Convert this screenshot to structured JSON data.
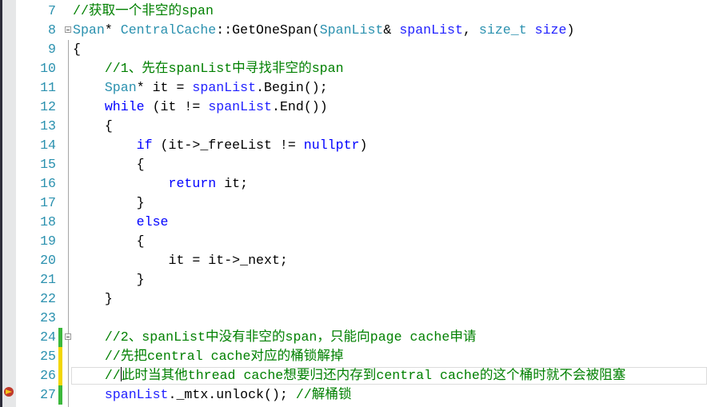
{
  "editor": {
    "colors": {
      "comment": "#008000",
      "keyword": "#0000ff",
      "type": "#2b91af",
      "parameter": "#1f1fff",
      "line_number": "#2b91af",
      "change_saved": "#3cb83c",
      "change_unsaved": "#f2d600"
    },
    "current_line": 26,
    "breakpoint_line": 27,
    "breakpoint_icon": "breakpoint-current-statement-icon",
    "lines": [
      {
        "n": "7",
        "chg": "",
        "tokens": [
          [
            "//获取一个非空的span",
            "cm"
          ]
        ]
      },
      {
        "n": "8",
        "chg": "",
        "fold": true,
        "tokens": [
          [
            "Span",
            "ty"
          ],
          [
            "* ",
            "tx"
          ],
          [
            "CentralCache",
            "ty"
          ],
          [
            "::GetOneSpan(",
            "tx"
          ],
          [
            "SpanList",
            "ty"
          ],
          [
            "& ",
            "tx"
          ],
          [
            "spanList",
            "pa"
          ],
          [
            ", ",
            "tx"
          ],
          [
            "size_t",
            "ty"
          ],
          [
            " ",
            "tx"
          ],
          [
            "size",
            "pa"
          ],
          [
            ")",
            "tx"
          ]
        ]
      },
      {
        "n": "9",
        "chg": "",
        "tokens": [
          [
            "{",
            "tx"
          ]
        ]
      },
      {
        "n": "10",
        "chg": "",
        "tokens": [
          [
            "    ",
            "tx"
          ],
          [
            "//1、先在spanList中寻找非空的span",
            "cm"
          ]
        ]
      },
      {
        "n": "11",
        "chg": "",
        "tokens": [
          [
            "    ",
            "tx"
          ],
          [
            "Span",
            "ty"
          ],
          [
            "* it = ",
            "tx"
          ],
          [
            "spanList",
            "pa"
          ],
          [
            ".Begin();",
            "tx"
          ]
        ]
      },
      {
        "n": "12",
        "chg": "",
        "tokens": [
          [
            "    ",
            "tx"
          ],
          [
            "while",
            "kw"
          ],
          [
            " (it != ",
            "tx"
          ],
          [
            "spanList",
            "pa"
          ],
          [
            ".End())",
            "tx"
          ]
        ]
      },
      {
        "n": "13",
        "chg": "",
        "tokens": [
          [
            "    {",
            "tx"
          ]
        ]
      },
      {
        "n": "14",
        "chg": "",
        "tokens": [
          [
            "        ",
            "tx"
          ],
          [
            "if",
            "kw"
          ],
          [
            " (it->_freeList != ",
            "tx"
          ],
          [
            "nullptr",
            "kw"
          ],
          [
            ")",
            "tx"
          ]
        ]
      },
      {
        "n": "15",
        "chg": "",
        "tokens": [
          [
            "        {",
            "tx"
          ]
        ]
      },
      {
        "n": "16",
        "chg": "",
        "tokens": [
          [
            "            ",
            "tx"
          ],
          [
            "return",
            "kw"
          ],
          [
            " it;",
            "tx"
          ]
        ]
      },
      {
        "n": "17",
        "chg": "",
        "tokens": [
          [
            "        }",
            "tx"
          ]
        ]
      },
      {
        "n": "18",
        "chg": "",
        "tokens": [
          [
            "        ",
            "tx"
          ],
          [
            "else",
            "kw"
          ]
        ]
      },
      {
        "n": "19",
        "chg": "",
        "tokens": [
          [
            "        {",
            "tx"
          ]
        ]
      },
      {
        "n": "20",
        "chg": "",
        "tokens": [
          [
            "            it = it->_next;",
            "tx"
          ]
        ]
      },
      {
        "n": "21",
        "chg": "",
        "tokens": [
          [
            "        }",
            "tx"
          ]
        ]
      },
      {
        "n": "22",
        "chg": "",
        "tokens": [
          [
            "    }",
            "tx"
          ]
        ]
      },
      {
        "n": "23",
        "chg": "",
        "tokens": []
      },
      {
        "n": "24",
        "chg": "saved",
        "fold": true,
        "tokens": [
          [
            "    ",
            "tx"
          ],
          [
            "//2、spanList中没有非空的span，只能向page cache申请",
            "cm"
          ]
        ]
      },
      {
        "n": "25",
        "chg": "unsaved",
        "tokens": [
          [
            "    ",
            "tx"
          ],
          [
            "//先把central cache对应的桶锁解掉",
            "cm"
          ]
        ]
      },
      {
        "n": "26",
        "chg": "unsaved",
        "caret_after": "    //",
        "tokens": [
          [
            "    ",
            "tx"
          ],
          [
            "//",
            "cm"
          ],
          [
            "|caret|",
            "caret"
          ],
          [
            "此时当其他thread cache想要归还内存到central cache的这个桶时就不会被阻塞",
            "cm"
          ]
        ]
      },
      {
        "n": "27",
        "chg": "saved",
        "tokens": [
          [
            "    ",
            "tx"
          ],
          [
            "spanList",
            "pa"
          ],
          [
            "._mtx.unlock(); ",
            "tx"
          ],
          [
            "//解桶锁",
            "cm"
          ]
        ]
      }
    ]
  }
}
